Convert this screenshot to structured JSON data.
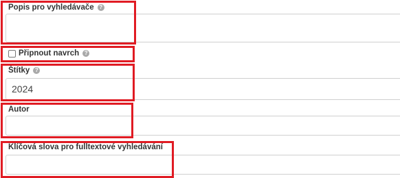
{
  "form": {
    "description": {
      "label": "Popis pro vyhledávače",
      "help_icon": "?",
      "value": ""
    },
    "pin_top": {
      "label": "Připnout navrch",
      "help_icon": "?",
      "checked": false
    },
    "tags": {
      "label": "Štítky",
      "help_icon": "?",
      "value": "2024"
    },
    "author": {
      "label": "Autor",
      "value": ""
    },
    "keywords": {
      "label": "Klíčová slova pro fulltextové vyhledávání",
      "value": ""
    }
  },
  "highlight_color": "#e01b23"
}
